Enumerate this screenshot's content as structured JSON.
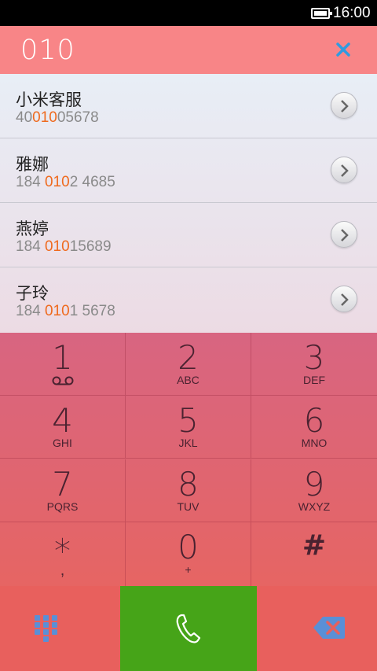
{
  "status_bar": {
    "time": "16:00"
  },
  "search": {
    "query": "010"
  },
  "results": [
    {
      "name": "小米客服",
      "number_prefix": "40",
      "number_match": "010",
      "number_suffix": "05678"
    },
    {
      "name": "雅娜",
      "number_prefix": "184 ",
      "number_match": "010",
      "number_suffix": "2 4685"
    },
    {
      "name": "燕婷",
      "number_prefix": "184 ",
      "number_match": "010",
      "number_suffix": "15689"
    },
    {
      "name": "子玲",
      "number_prefix": "184 ",
      "number_match": "010",
      "number_suffix": "1 5678"
    }
  ],
  "keypad": [
    {
      "digit": "1",
      "letters": ""
    },
    {
      "digit": "2",
      "letters": "ABC"
    },
    {
      "digit": "3",
      "letters": "DEF"
    },
    {
      "digit": "4",
      "letters": "GHI"
    },
    {
      "digit": "5",
      "letters": "JKL"
    },
    {
      "digit": "6",
      "letters": "MNO"
    },
    {
      "digit": "7",
      "letters": "PQRS"
    },
    {
      "digit": "8",
      "letters": "TUV"
    },
    {
      "digit": "9",
      "letters": "WXYZ"
    },
    {
      "digit": "*",
      "letters": ","
    },
    {
      "digit": "0",
      "letters": "+"
    },
    {
      "digit": "#",
      "letters": ""
    }
  ],
  "icons": {
    "close": "close-icon",
    "detail": "chevron-right-icon",
    "voicemail": "voicemail-icon",
    "dialpad": "dialpad-grid-icon",
    "call": "phone-icon",
    "backspace": "backspace-icon"
  },
  "colors": {
    "header": "#f88587",
    "highlight": "#ef6a1e",
    "call_button": "#46a418",
    "close_icon": "#2f9be0",
    "dialpad_icon": "#5a8fd6"
  }
}
